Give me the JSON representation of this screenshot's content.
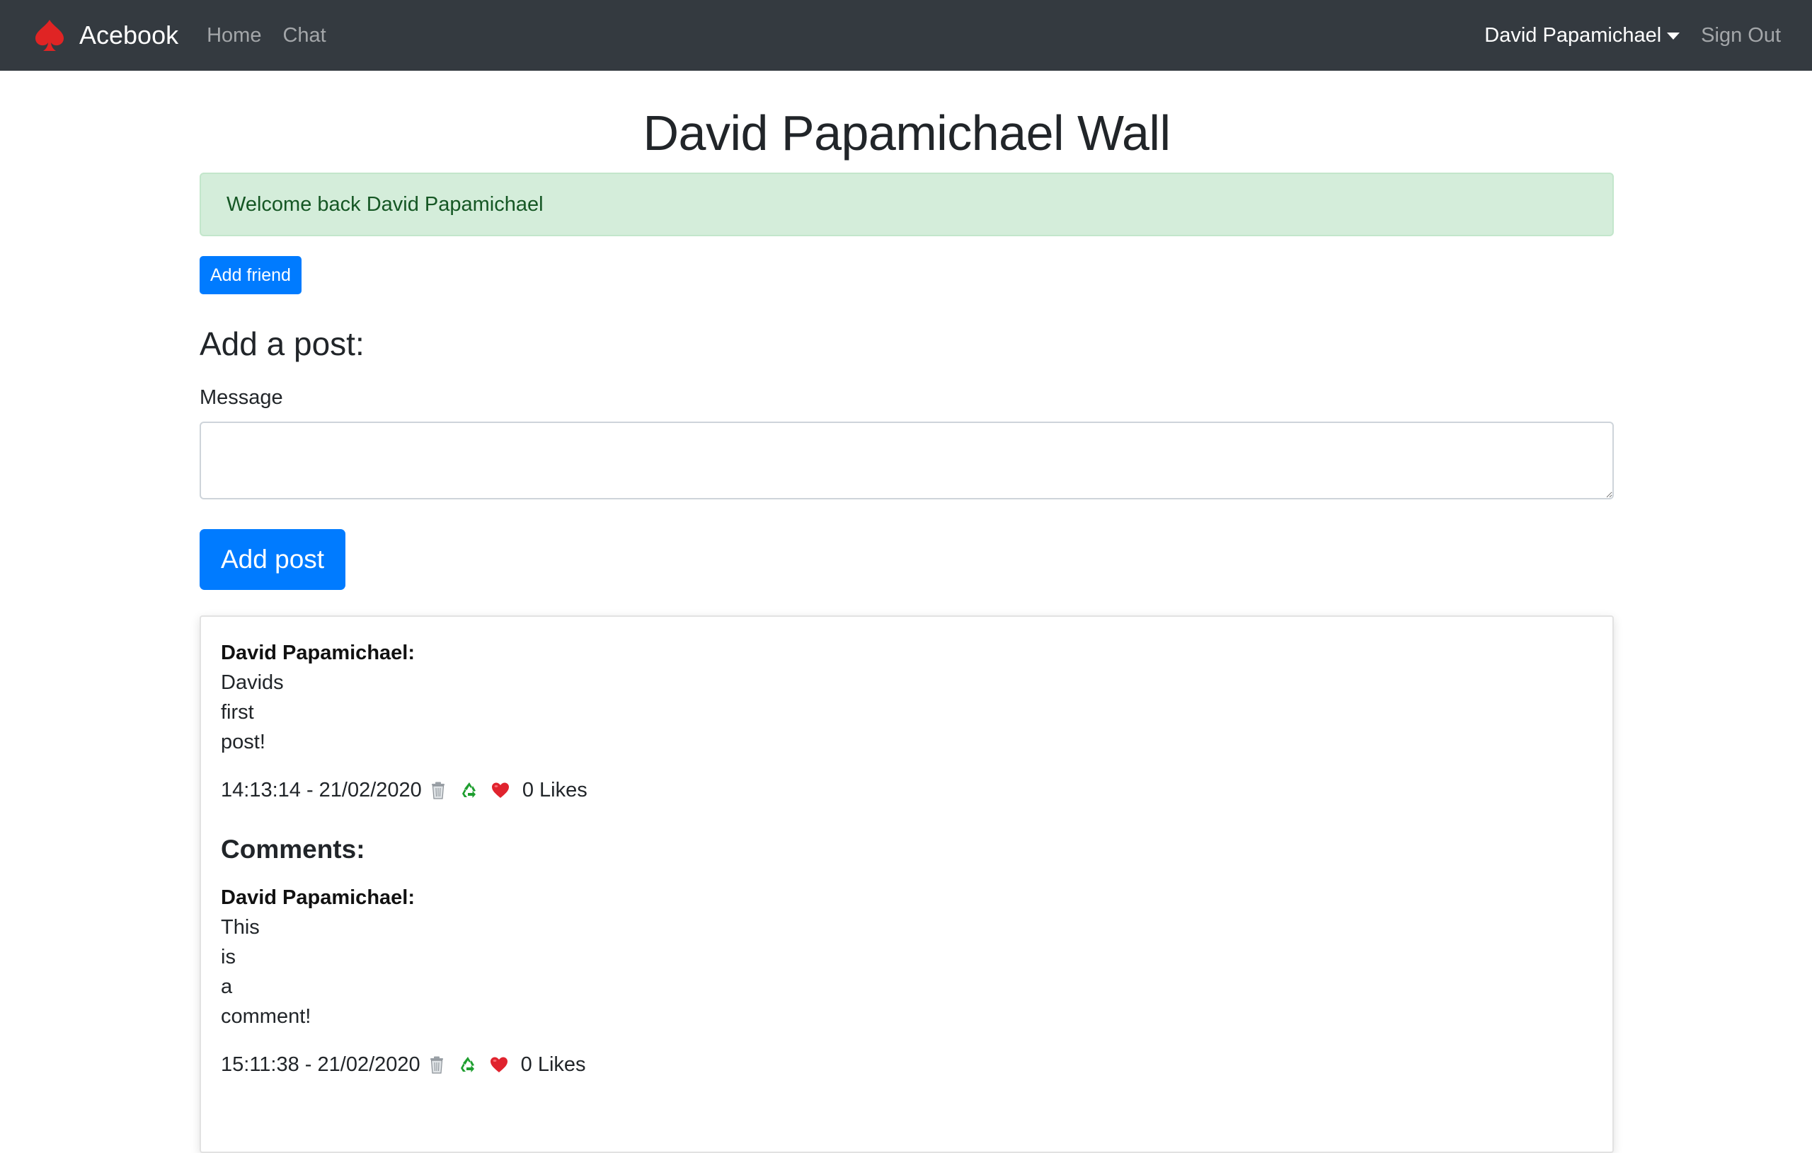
{
  "navbar": {
    "brand": "Acebook",
    "brand_icon": "spade-icon",
    "links": [
      {
        "label": "Home"
      },
      {
        "label": "Chat"
      }
    ],
    "user_name": "David Papamichael",
    "sign_out": "Sign Out"
  },
  "page": {
    "title": "David Papamichael Wall",
    "alert": "Welcome back David Papamichael",
    "add_friend": "Add friend",
    "add_post_heading": "Add a post:",
    "message_label": "Message",
    "message_value": "",
    "add_post_button": "Add post"
  },
  "post": {
    "author": "David Papamichael:",
    "lines": [
      "Davids",
      "first",
      "post!"
    ],
    "timestamp": "14:13:14 - 21/02/2020",
    "likes": "0 Likes",
    "icons": [
      "trash-icon",
      "recycle-icon",
      "heart-icon"
    ],
    "comments_heading": "Comments:",
    "comments": [
      {
        "author": "David Papamichael:",
        "lines": [
          "This",
          "is",
          "a",
          "comment!"
        ],
        "timestamp": "15:11:38 - 21/02/2020",
        "likes": "0 Likes"
      }
    ]
  },
  "colors": {
    "navbar": "#343a40",
    "primary": "#007bff",
    "alert_bg": "#d4edda",
    "alert_text": "#155724",
    "brand_icon": "#e02424"
  }
}
